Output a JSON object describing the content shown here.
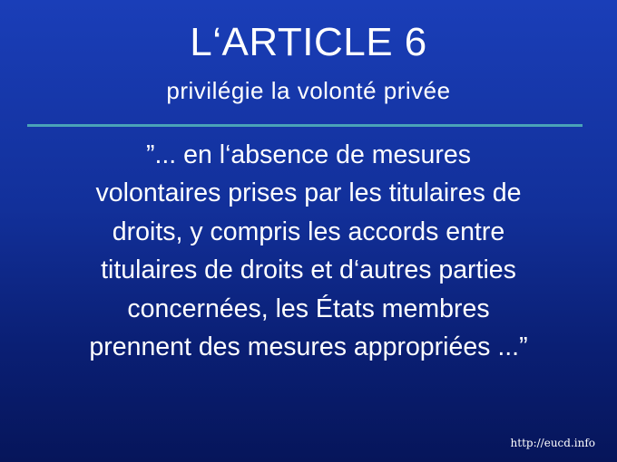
{
  "slide": {
    "title": "L‘ARTICLE 6",
    "subtitle": "privilégie la volonté privée",
    "quote_lines": [
      "”... en l‘absence de mesures",
      "volontaires prises par les titulaires de",
      "droits, y compris les accords entre",
      "titulaires de droits et d‘autres parties",
      "concernées, les États membres",
      "prennent des mesures appropriées ...”"
    ],
    "footer_url": "http://eucd.info"
  },
  "colors": {
    "background_top": "#1a3eb8",
    "background_bottom": "#06155a",
    "text": "#ffffff",
    "divider": "#4aa3b8"
  }
}
